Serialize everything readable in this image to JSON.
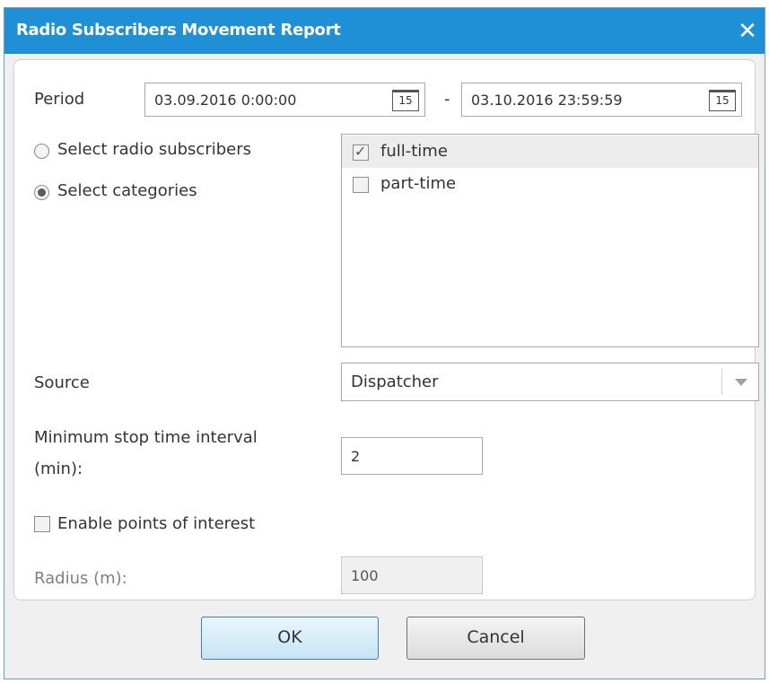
{
  "dialog": {
    "title": "Radio Subscribers Movement Report",
    "close_icon": "close-icon"
  },
  "period": {
    "label": "Period",
    "from_value": "03.09.2016 0:00:00",
    "to_value": "03.10.2016 23:59:59",
    "separator": "-",
    "calendar_icon_text": "15"
  },
  "selection": {
    "radio_subscribers_label": "Select radio subscribers",
    "categories_label": "Select categories",
    "selected": "categories"
  },
  "categories": [
    {
      "label": "full-time",
      "checked": true
    },
    {
      "label": "part-time",
      "checked": false
    }
  ],
  "source": {
    "label": "Source",
    "value": "Dispatcher"
  },
  "min_stop": {
    "label_line1": "Minimum stop time interval",
    "label_line2": "(min):",
    "value": "2"
  },
  "poi": {
    "label": "Enable points of interest",
    "checked": false
  },
  "radius": {
    "label": "Radius (m):",
    "value": "100"
  },
  "buttons": {
    "ok": "OK",
    "cancel": "Cancel"
  },
  "colors": {
    "titlebar": "#1f8fd6",
    "ok_border": "#3c7fb1"
  }
}
